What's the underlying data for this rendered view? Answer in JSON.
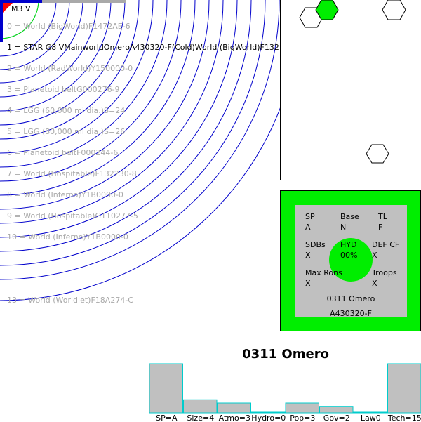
{
  "system": {
    "star": "M3 V",
    "orbits": [
      {
        "label": "0 = World  (BigWorld)F1472AE-6",
        "main": false
      },
      {
        "label": "1 = STAR G8 VMainworldOmeroA430320-F(Cold)World  (BigWorld)F132",
        "main": true
      },
      {
        "label": "2 = World  (RadWorld)Y150000-0",
        "main": false
      },
      {
        "label": "3 = Planetoid beltG000276-9",
        "main": false
      },
      {
        "label": "4 = LGG (60,000 mi dia.)S=24",
        "main": false
      },
      {
        "label": "5 = LGG (80,000 mi dia.)S=26",
        "main": false
      },
      {
        "label": "6 = Planetoid beltF000244-6",
        "main": false
      },
      {
        "label": "7 = World  (Hospitable)F132230-8",
        "main": false
      },
      {
        "label": "8 = World  (Inferno)Y1B0000-0",
        "main": false
      },
      {
        "label": "9 = World  (Hospitable)G110277-5",
        "main": false
      },
      {
        "label": "10 = World  (Inferno)Y1B0000-0",
        "main": false
      },
      {
        "label": "13 = World  (Worldlet)F18A274-C",
        "main": false
      }
    ]
  },
  "world_info": {
    "sp": {
      "label": "SP",
      "value": "A"
    },
    "base": {
      "label": "Base",
      "value": "N"
    },
    "tl": {
      "label": "TL",
      "value": "F"
    },
    "sdbs": {
      "label": "SDBs",
      "value": "X"
    },
    "hyd": {
      "label": "HYD",
      "value": "00%"
    },
    "def_cf": {
      "label": "DEF CF",
      "value": "X"
    },
    "max_rons": {
      "label": "Max Rons",
      "value": "X"
    },
    "troops": {
      "label": "Troops",
      "value": "X"
    },
    "name": "0311 Omero",
    "uwp": "A430320-F"
  },
  "colors": {
    "orbit": "#0000cc",
    "green": "#00ee00",
    "grey": "#c0c0c0",
    "bar_border": "#00cccc"
  },
  "chart_data": {
    "type": "bar",
    "title": "0311 Omero",
    "categories": [
      "SP=A",
      "Size=4",
      "Atmo=3",
      "Hydro=0",
      "Pop=3",
      "Gov=2",
      "Law0",
      "Tech=15"
    ],
    "values": [
      15,
      4,
      3,
      0,
      3,
      2,
      0,
      15
    ],
    "ylim": [
      0,
      15
    ]
  }
}
